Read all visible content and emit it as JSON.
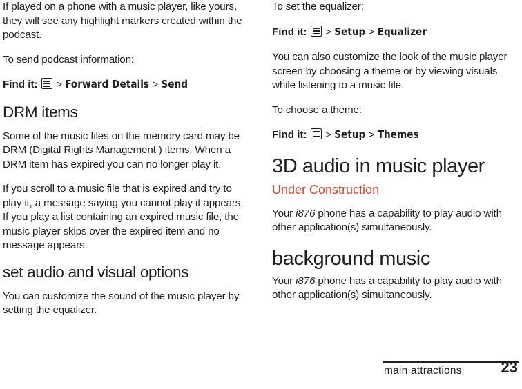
{
  "left_column": {
    "para_intro": "If played on a phone with a music player, like yours, they will see any highlight markers created within the podcast.",
    "para_send_intro": "To send podcast information:",
    "finditer_send": {
      "lead": "Find it:",
      "icon": "menu-key-icon",
      "sep1": ">",
      "item1": "Forward Details",
      "sep2": ">",
      "item2": "Send"
    },
    "heading_drm": "DRM items",
    "para_drm_1": "Some of the music files on the memory card may be DRM (Digital Rights Management ) items. When a DRM item has expired you can no longer play it.",
    "para_drm_2": "If you scroll to a music file that is expired and try to play it, a message saying you cannot play it appears. If you play a list containing an expired music file, the music player skips over the expired item and no message appears.",
    "heading_audio_visual": "set audio and visual options",
    "para_customize": "You can customize the sound of the music player by setting the equalizer."
  },
  "right_column": {
    "para_equalizer_intro": "To set the equalizer:",
    "finditer_equalizer": {
      "lead": "Find it:",
      "icon": "menu-key-icon",
      "sep1": ">",
      "item1": "Setup",
      "sep2": ">",
      "item2": "Equalizer"
    },
    "para_theme": "You can also customize the look of the music player screen by choosing a theme or by viewing visuals while listening to a music file.",
    "para_choose_theme": "To choose a theme:",
    "finditer_themes": {
      "lead": "Find it:",
      "icon": "menu-key-icon",
      "sep1": ">",
      "item1": "Setup",
      "sep2": ">",
      "item2": "Themes"
    },
    "heading_3d_audio": "3D audio in music player",
    "under_construction": "Under Construction",
    "para_3d_1_pre": "Your ",
    "para_3d_1_model": "i876",
    "para_3d_1_post": " phone has a capability to play audio with other application(s) simultaneously.",
    "heading_background_music": "background music",
    "para_bg_pre": "Your ",
    "para_bg_model": "i876",
    "para_bg_post": " phone has a capability to play audio with other application(s) simultaneously."
  },
  "footer": {
    "label": "main attractions",
    "page_number": "23"
  },
  "colors": {
    "text": "#231f20",
    "accent_red": "#d4452c"
  }
}
